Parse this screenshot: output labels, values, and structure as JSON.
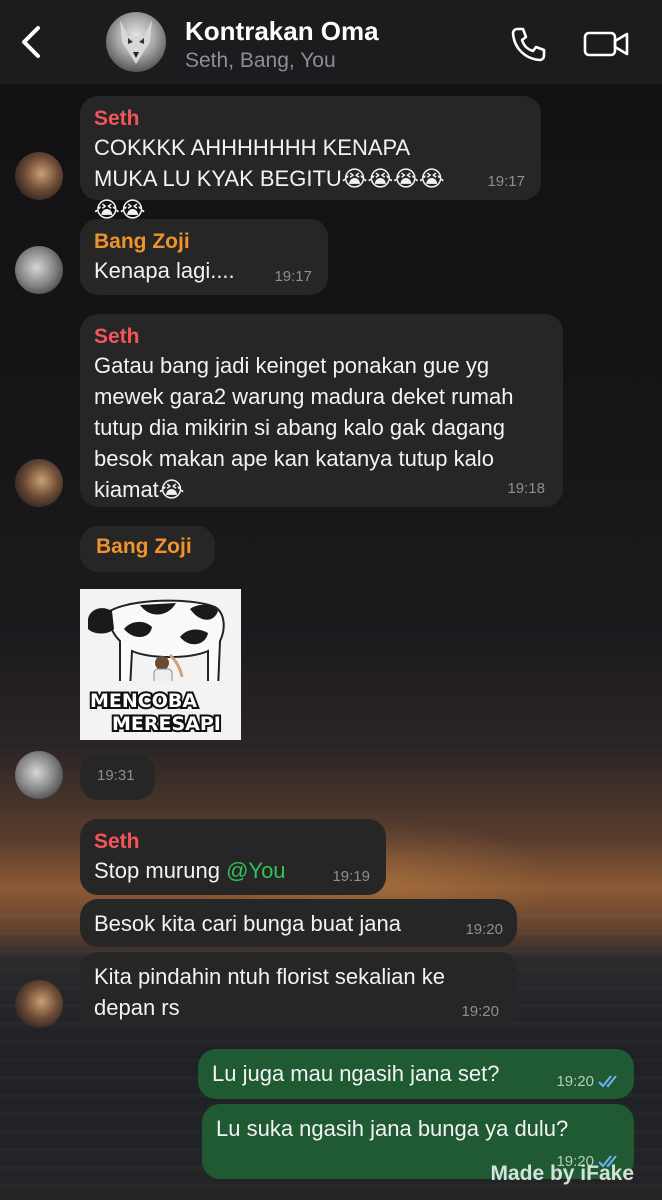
{
  "header": {
    "title": "Kontrakan Oma",
    "subtitle": "Seth, Bang, You"
  },
  "messages": [
    {
      "sender": "Seth",
      "text": "COKKKK AHHHHHHH KENAPA MUKA LU KYAK BEGITU😭😭😭😭😭😭",
      "time": "19:17"
    },
    {
      "sender": "Bang Zoji",
      "text": "Kenapa lagi....",
      "time": "19:17"
    },
    {
      "sender": "Seth",
      "text": "Gatau bang jadi keinget ponakan gue yg mewek gara2 warung madura deket rumah tutup dia mikirin si abang kalo gak dagang besok makan ape kan katanya tutup kalo kiamat😭",
      "time": "19:18"
    },
    {
      "sender": "Bang Zoji",
      "image_caption": "MENCOBA MERESAPI",
      "time": "19:31"
    },
    {
      "sender": "Seth",
      "text_prefix": "Stop murung ",
      "mention": "@You",
      "time": "19:19"
    },
    {
      "text": "Besok kita cari bunga buat jana",
      "time": "19:20"
    },
    {
      "text": "Kita pindahin ntuh florist sekalian ke depan rs",
      "time": "19:20"
    },
    {
      "outgoing": true,
      "text": "Lu juga mau ngasih jana set?",
      "time": "19:20"
    },
    {
      "outgoing": true,
      "text": "Lu suka ngasih jana bunga ya dulu?",
      "time": "19:20"
    }
  ],
  "watermark": "Made by iFake",
  "colors": {
    "seth": "#f2555a",
    "zoji": "#f0932b",
    "mention": "#31c158",
    "outgoing_bubble": "#1f5a32",
    "incoming_bubble": "#262626"
  }
}
